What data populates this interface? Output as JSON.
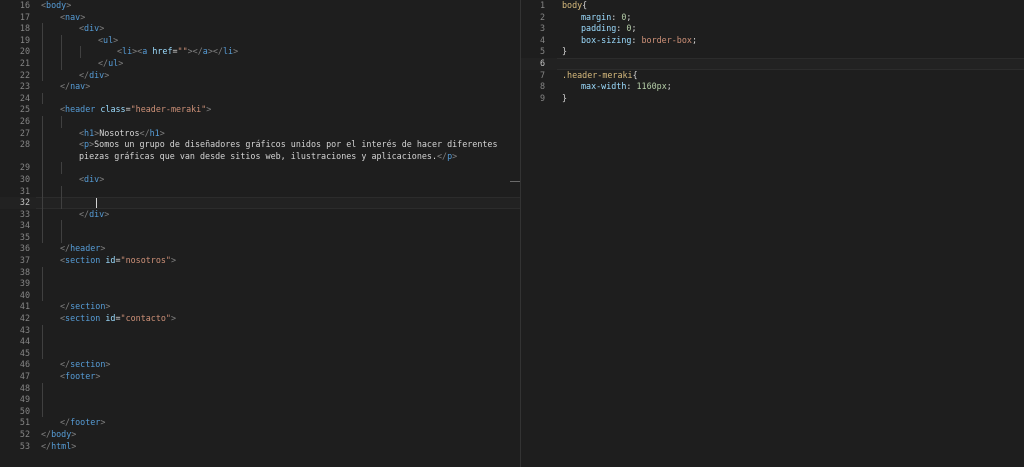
{
  "editor_left": {
    "lines": [
      {
        "n": "16",
        "indent": 0,
        "tokens": [
          [
            "br",
            "<"
          ],
          [
            "tag",
            "body"
          ],
          [
            "br",
            ">"
          ]
        ]
      },
      {
        "n": "17",
        "indent": 1,
        "tokens": [
          [
            "br",
            "<"
          ],
          [
            "tag",
            "nav"
          ],
          [
            "br",
            ">"
          ]
        ]
      },
      {
        "n": "18",
        "indent": 2,
        "tokens": [
          [
            "br",
            "<"
          ],
          [
            "tag",
            "div"
          ],
          [
            "br",
            ">"
          ]
        ]
      },
      {
        "n": "19",
        "indent": 3,
        "tokens": [
          [
            "br",
            "<"
          ],
          [
            "tag",
            "ul"
          ],
          [
            "br",
            ">"
          ]
        ]
      },
      {
        "n": "20",
        "indent": 4,
        "tokens": [
          [
            "br",
            "<"
          ],
          [
            "tag",
            "li"
          ],
          [
            "br",
            "><"
          ],
          [
            "tag",
            "a"
          ],
          [
            "text",
            " "
          ],
          [
            "attr",
            "href"
          ],
          [
            "text",
            "="
          ],
          [
            "str",
            "\"\""
          ],
          [
            "br",
            "></"
          ],
          [
            "tag",
            "a"
          ],
          [
            "br",
            "></"
          ],
          [
            "tag",
            "li"
          ],
          [
            "br",
            ">"
          ]
        ]
      },
      {
        "n": "21",
        "indent": 3,
        "tokens": [
          [
            "br",
            "</"
          ],
          [
            "tag",
            "ul"
          ],
          [
            "br",
            ">"
          ]
        ]
      },
      {
        "n": "22",
        "indent": 2,
        "tokens": [
          [
            "br",
            "</"
          ],
          [
            "tag",
            "div"
          ],
          [
            "br",
            ">"
          ]
        ]
      },
      {
        "n": "23",
        "indent": 1,
        "tokens": [
          [
            "br",
            "</"
          ],
          [
            "tag",
            "nav"
          ],
          [
            "br",
            ">"
          ]
        ]
      },
      {
        "n": "24",
        "indent": 0,
        "tokens": []
      },
      {
        "n": "25",
        "indent": 1,
        "tokens": [
          [
            "br",
            "<"
          ],
          [
            "tag",
            "header"
          ],
          [
            "text",
            " "
          ],
          [
            "attr",
            "class"
          ],
          [
            "text",
            "="
          ],
          [
            "str",
            "\"header-meraki\""
          ],
          [
            "br",
            ">"
          ]
        ]
      },
      {
        "n": "26",
        "indent": 0,
        "tokens": []
      },
      {
        "n": "27",
        "indent": 2,
        "tokens": [
          [
            "br",
            "<"
          ],
          [
            "tag",
            "h1"
          ],
          [
            "br",
            ">"
          ],
          [
            "text",
            "Nosotros"
          ],
          [
            "br",
            "</"
          ],
          [
            "tag",
            "h1"
          ],
          [
            "br",
            ">"
          ]
        ]
      },
      {
        "n": "28",
        "indent": 2,
        "wrapped": true,
        "tokens": [
          [
            "br",
            "<"
          ],
          [
            "tag",
            "p"
          ],
          [
            "br",
            ">"
          ],
          [
            "text",
            "Somos un grupo de diseñadores gráficos unidos por el interés de hacer diferentes\npiezas gráficas que van desde sitios web, ilustraciones y aplicaciones."
          ],
          [
            "br",
            "</"
          ],
          [
            "tag",
            "p"
          ],
          [
            "br",
            ">"
          ]
        ]
      },
      {
        "n": "29",
        "indent": 0,
        "tokens": []
      },
      {
        "n": "30",
        "indent": 2,
        "tokens": [
          [
            "br",
            "<"
          ],
          [
            "tag",
            "div"
          ],
          [
            "br",
            ">"
          ]
        ]
      },
      {
        "n": "31",
        "indent": 0,
        "tokens": []
      },
      {
        "n": "32",
        "indent": 0,
        "current": true,
        "tokens": []
      },
      {
        "n": "33",
        "indent": 2,
        "tokens": [
          [
            "br",
            "</"
          ],
          [
            "tag",
            "div"
          ],
          [
            "br",
            ">"
          ]
        ]
      },
      {
        "n": "34",
        "indent": 0,
        "tokens": []
      },
      {
        "n": "35",
        "indent": 0,
        "tokens": []
      },
      {
        "n": "36",
        "indent": 1,
        "tokens": [
          [
            "br",
            "</"
          ],
          [
            "tag",
            "header"
          ],
          [
            "br",
            ">"
          ]
        ]
      },
      {
        "n": "37",
        "indent": 1,
        "tokens": [
          [
            "br",
            "<"
          ],
          [
            "tag",
            "section"
          ],
          [
            "text",
            " "
          ],
          [
            "attr",
            "id"
          ],
          [
            "text",
            "="
          ],
          [
            "str",
            "\"nosotros\""
          ],
          [
            "br",
            ">"
          ]
        ]
      },
      {
        "n": "38",
        "indent": 0,
        "tokens": []
      },
      {
        "n": "39",
        "indent": 0,
        "tokens": []
      },
      {
        "n": "40",
        "indent": 0,
        "tokens": []
      },
      {
        "n": "41",
        "indent": 1,
        "tokens": [
          [
            "br",
            "</"
          ],
          [
            "tag",
            "section"
          ],
          [
            "br",
            ">"
          ]
        ]
      },
      {
        "n": "42",
        "indent": 1,
        "tokens": [
          [
            "br",
            "<"
          ],
          [
            "tag",
            "section"
          ],
          [
            "text",
            " "
          ],
          [
            "attr",
            "id"
          ],
          [
            "text",
            "="
          ],
          [
            "str",
            "\"contacto\""
          ],
          [
            "br",
            ">"
          ]
        ]
      },
      {
        "n": "43",
        "indent": 0,
        "tokens": []
      },
      {
        "n": "44",
        "indent": 0,
        "tokens": []
      },
      {
        "n": "45",
        "indent": 0,
        "tokens": []
      },
      {
        "n": "46",
        "indent": 1,
        "tokens": [
          [
            "br",
            "</"
          ],
          [
            "tag",
            "section"
          ],
          [
            "br",
            ">"
          ]
        ]
      },
      {
        "n": "47",
        "indent": 1,
        "tokens": [
          [
            "br",
            "<"
          ],
          [
            "tag",
            "footer"
          ],
          [
            "br",
            ">"
          ]
        ]
      },
      {
        "n": "48",
        "indent": 0,
        "tokens": []
      },
      {
        "n": "49",
        "indent": 0,
        "tokens": []
      },
      {
        "n": "50",
        "indent": 0,
        "tokens": []
      },
      {
        "n": "51",
        "indent": 1,
        "tokens": [
          [
            "br",
            "</"
          ],
          [
            "tag",
            "footer"
          ],
          [
            "br",
            ">"
          ]
        ]
      },
      {
        "n": "52",
        "indent": 0,
        "tokens": [
          [
            "br",
            "</"
          ],
          [
            "tag",
            "body"
          ],
          [
            "br",
            ">"
          ]
        ]
      },
      {
        "n": "53",
        "indent": 0,
        "tokens": [
          [
            "br",
            "</"
          ],
          [
            "tag",
            "html"
          ],
          [
            "br",
            ">"
          ]
        ]
      }
    ]
  },
  "editor_right": {
    "lines": [
      {
        "n": "1",
        "indent": 0,
        "tokens": [
          [
            "sel",
            "body"
          ],
          [
            "text",
            "{"
          ]
        ]
      },
      {
        "n": "2",
        "indent": 1,
        "tokens": [
          [
            "prop",
            "margin"
          ],
          [
            "text",
            ": "
          ],
          [
            "num",
            "0"
          ],
          [
            "text",
            ";"
          ]
        ]
      },
      {
        "n": "3",
        "indent": 1,
        "tokens": [
          [
            "prop",
            "padding"
          ],
          [
            "text",
            ": "
          ],
          [
            "num",
            "0"
          ],
          [
            "text",
            ";"
          ]
        ]
      },
      {
        "n": "4",
        "indent": 1,
        "tokens": [
          [
            "prop",
            "box-sizing"
          ],
          [
            "text",
            ": "
          ],
          [
            "val",
            "border-box"
          ],
          [
            "text",
            ";"
          ]
        ]
      },
      {
        "n": "5",
        "indent": 0,
        "tokens": [
          [
            "text",
            "}"
          ]
        ]
      },
      {
        "n": "6",
        "indent": 0,
        "current": true,
        "tokens": []
      },
      {
        "n": "7",
        "indent": 0,
        "tokens": [
          [
            "sel",
            ".header-meraki"
          ],
          [
            "text",
            "{"
          ]
        ]
      },
      {
        "n": "8",
        "indent": 1,
        "tokens": [
          [
            "prop",
            "max-width"
          ],
          [
            "text",
            ": "
          ],
          [
            "num",
            "1160px"
          ],
          [
            "text",
            ";"
          ]
        ]
      },
      {
        "n": "9",
        "indent": 0,
        "tokens": [
          [
            "text",
            "}"
          ]
        ]
      }
    ]
  }
}
